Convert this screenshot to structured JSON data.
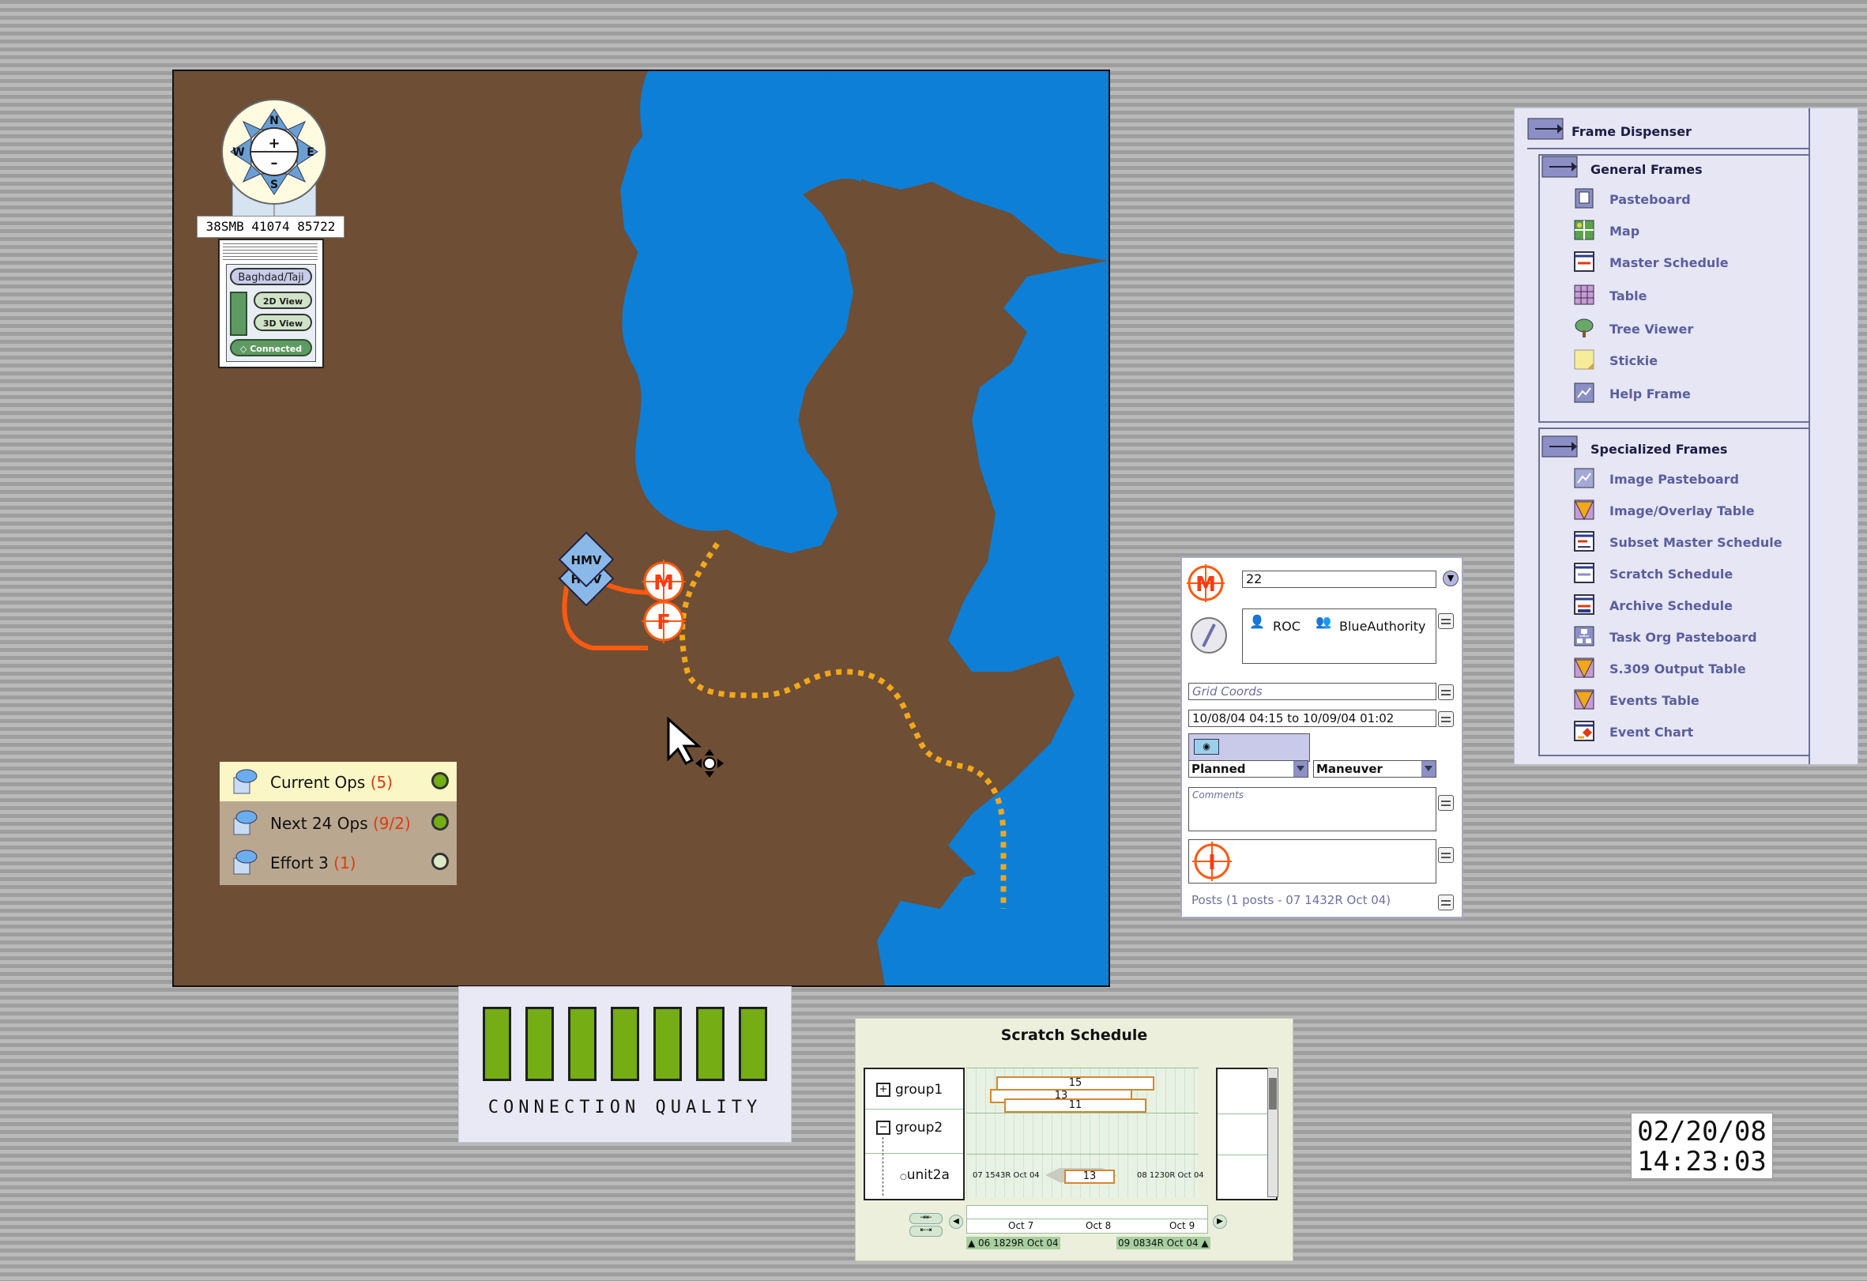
{
  "map": {
    "coordinates": "38SMB  41074  85722",
    "compass": {
      "n": "N",
      "s": "S",
      "e": "E",
      "w": "W",
      "zoom_in": "+",
      "zoom_out": "–"
    },
    "view_panel": {
      "location": "Baghdad/Taji",
      "view_2d": "2D View",
      "view_3d": "3D View",
      "status": "Connected"
    },
    "units": [
      {
        "symbol": "HMV"
      },
      {
        "symbol": "HMV"
      },
      {
        "symbol": "M"
      },
      {
        "symbol": "F"
      }
    ],
    "colors": {
      "land": "#6e4e35",
      "water": "#0d7fd6",
      "route": "#f2a81a",
      "link": "#ff5a10"
    },
    "ops": [
      {
        "label": "Current Ops",
        "count": "(5)",
        "active": true,
        "dot": "#74ad14"
      },
      {
        "label": "Next 24 Ops",
        "count": "(9/2)",
        "active": false,
        "dot": "#74ad14"
      },
      {
        "label": "Effort 3",
        "count": "(1)",
        "active": false,
        "dot": "#dde8c4"
      }
    ]
  },
  "connection_quality": {
    "label": "CONNECTION QUALITY",
    "bars_lit": 7,
    "bar_color": "#74ad14"
  },
  "scratch_schedule": {
    "title": "Scratch Schedule",
    "rows": [
      {
        "label": "group1",
        "icon": "plus-box-icon"
      },
      {
        "label": "group2",
        "icon": "minus-box-icon"
      },
      {
        "label": "unit2a",
        "icon": "node-icon"
      }
    ],
    "bars": [
      "15",
      "13",
      "11",
      "13"
    ],
    "unit_start": "07 1543R Oct 04",
    "unit_end": "08 1230R Oct 04",
    "timeline_dates": [
      "Oct 7",
      "Oct 8",
      "Oct 9"
    ],
    "range_start": "06 1829R Oct 04",
    "range_end": "09 0834R Oct 04"
  },
  "editor": {
    "id_value": "22",
    "assigned": [
      "ROC",
      "BlueAuthority"
    ],
    "grid_placeholder": "Grid Coords",
    "time_range": "10/08/04 04:15 to 10/09/04 01:02",
    "status_select": "Planned",
    "type_select": "Maneuver",
    "comments_placeholder": "Comments",
    "posts": "Posts (1 posts - 07 1432R Oct 04)"
  },
  "frame_dispenser": {
    "title": "Frame Dispenser",
    "general": {
      "title": "General Frames",
      "items": [
        {
          "label": "Pasteboard",
          "icon": "pasteboard-icon"
        },
        {
          "label": "Map",
          "icon": "map-icon"
        },
        {
          "label": "Master Schedule",
          "icon": "master-schedule-icon"
        },
        {
          "label": "Table",
          "icon": "table-icon"
        },
        {
          "label": "Tree Viewer",
          "icon": "tree-icon"
        },
        {
          "label": "Stickie",
          "icon": "stickie-icon"
        },
        {
          "label": "Help Frame",
          "icon": "help-icon"
        }
      ]
    },
    "specialized": {
      "title": "Specialized Frames",
      "items": [
        {
          "label": "Image Pasteboard",
          "icon": "image-icon"
        },
        {
          "label": "Image/Overlay Table",
          "icon": "funnel-table-icon"
        },
        {
          "label": "Subset Master Schedule",
          "icon": "subset-schedule-icon"
        },
        {
          "label": "Scratch Schedule",
          "icon": "scratch-schedule-icon"
        },
        {
          "label": "Archive Schedule",
          "icon": "archive-schedule-icon"
        },
        {
          "label": "Task Org Pasteboard",
          "icon": "org-chart-icon"
        },
        {
          "label": "S.309 Output Table",
          "icon": "funnel-table-icon"
        },
        {
          "label": "Events Table",
          "icon": "funnel-table-icon"
        },
        {
          "label": "Event Chart",
          "icon": "event-chart-icon"
        }
      ]
    }
  },
  "clock": {
    "date": "02/20/08",
    "time": "14:23:03"
  }
}
